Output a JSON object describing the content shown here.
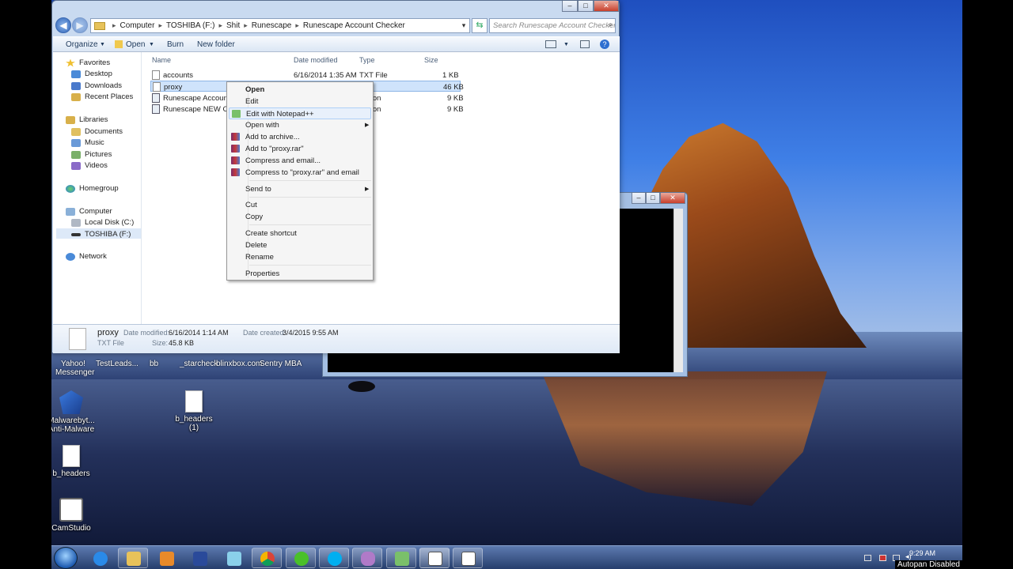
{
  "address": {
    "path": [
      "Computer",
      "TOSHIBA (F:)",
      "Shit",
      "Runescape",
      "Runescape Account Checker"
    ]
  },
  "search": {
    "placeholder": "Search Runescape Account Checker"
  },
  "toolbar": {
    "organize": "Organize",
    "open": "Open",
    "burn": "Burn",
    "new_folder": "New folder"
  },
  "nav": {
    "favorites": "Favorites",
    "desktop": "Desktop",
    "downloads": "Downloads",
    "recent": "Recent Places",
    "libraries": "Libraries",
    "documents": "Documents",
    "music": "Music",
    "pictures": "Pictures",
    "videos": "Videos",
    "homegroup": "Homegroup",
    "computer": "Computer",
    "local_disk": "Local Disk (C:)",
    "toshiba": "TOSHIBA (F:)",
    "network": "Network"
  },
  "columns": {
    "name": "Name",
    "date": "Date modified",
    "type": "Type",
    "size": "Size"
  },
  "files": [
    {
      "name": "accounts",
      "date": "6/16/2014 1:35 AM",
      "type": "TXT File",
      "size": "1 KB"
    },
    {
      "name": "proxy",
      "date": "",
      "type": "File",
      "size": "46 KB"
    },
    {
      "name": "Runescape Account C",
      "date": "",
      "type": "ication",
      "size": "9 KB"
    },
    {
      "name": "Runescape NEW Chec",
      "date": "",
      "type": "ication",
      "size": "9 KB"
    }
  ],
  "context_menu": {
    "open": "Open",
    "edit": "Edit",
    "edit_notepad": "Edit with Notepad++",
    "open_with": "Open with",
    "add_archive": "Add to archive...",
    "add_rar": "Add to \"proxy.rar\"",
    "compress_email": "Compress and email...",
    "compress_rar_email": "Compress to \"proxy.rar\" and email",
    "send_to": "Send to",
    "cut": "Cut",
    "copy": "Copy",
    "create_shortcut": "Create shortcut",
    "delete": "Delete",
    "rename": "Rename",
    "properties": "Properties"
  },
  "details": {
    "name": "proxy",
    "type": "TXT File",
    "date_modified_label": "Date modified:",
    "date_modified": "6/16/2014 1:14 AM",
    "size_label": "Size:",
    "size": "45.8 KB",
    "date_created_label": "Date created:",
    "date_created": "3/4/2015 9:55 AM"
  },
  "desktop": {
    "top_labels": [
      "Yahoo!",
      "TestLeads...",
      "bb",
      "_starcheck",
      "blinxbox.com",
      "Sentry MBA"
    ],
    "messenger": "Messenger",
    "malwarebytes": "Malwarebyt... Anti-Malware",
    "b_headers_1": "b_headers (1)",
    "b_headers": "b_headers",
    "camstudio": "CamStudio"
  },
  "tray": {
    "clock": "9:29 AM",
    "autopan": "Autopan Disabled"
  }
}
